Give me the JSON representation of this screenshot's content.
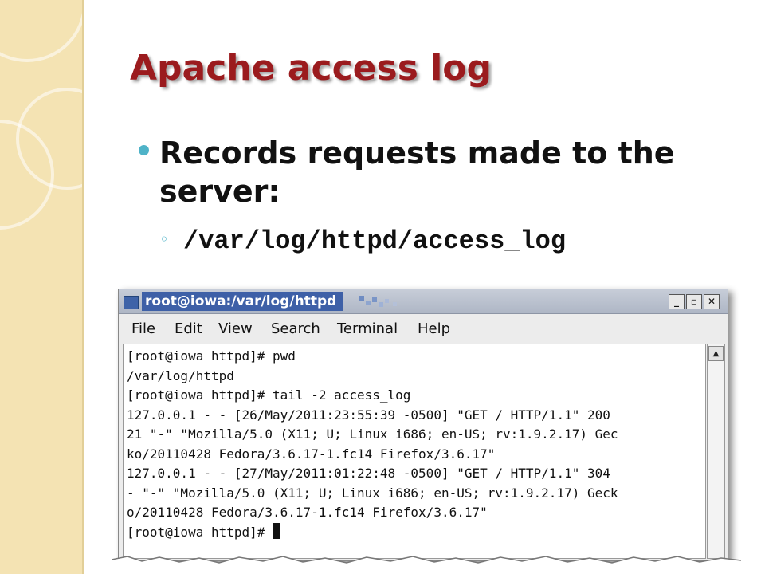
{
  "slide": {
    "title": "Apache access log",
    "bullet": "Records requests made to the server:",
    "sub_bullet_marker": "◦",
    "sub_bullet": "/var/log/httpd/access_log"
  },
  "terminal": {
    "window_title": "root@iowa:/var/log/httpd",
    "buttons": {
      "minimize": "_",
      "maximize": "▫",
      "close": "✕"
    },
    "menu": [
      "File",
      "Edit",
      "View",
      "Search",
      "Terminal",
      "Help"
    ],
    "lines": [
      "[root@iowa httpd]# pwd",
      "/var/log/httpd",
      "[root@iowa httpd]# tail -2 access_log",
      "127.0.0.1 - - [26/May/2011:23:55:39 -0500] \"GET / HTTP/1.1\" 200",
      "21 \"-\" \"Mozilla/5.0 (X11; U; Linux i686; en-US; rv:1.9.2.17) Gec",
      "ko/20110428 Fedora/3.6.17-1.fc14 Firefox/3.6.17\"",
      "127.0.0.1 - - [27/May/2011:01:22:48 -0500] \"GET / HTTP/1.1\" 304",
      "- \"-\" \"Mozilla/5.0 (X11; U; Linux i686; en-US; rv:1.9.2.17) Geck",
      "o/20110428 Fedora/3.6.17-1.fc14 Firefox/3.6.17\"",
      "[root@iowa httpd]# "
    ]
  },
  "colors": {
    "title": "#9b1b1e",
    "bullet": "#4fb3c8",
    "side_strip": "#f4e3b3",
    "titlebar_highlight": "#3e60a7"
  }
}
